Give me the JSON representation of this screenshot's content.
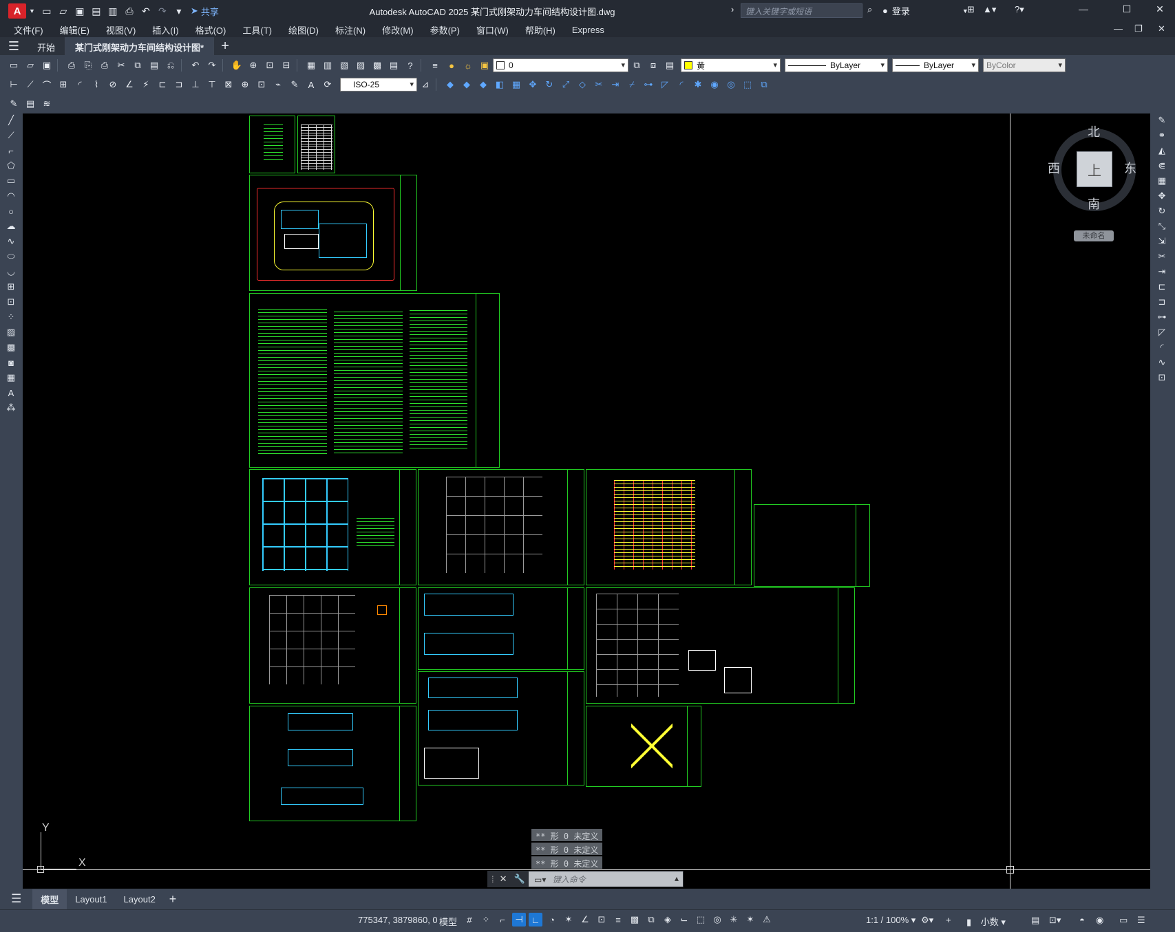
{
  "titlebar": {
    "logo": "A",
    "share_label": "共享",
    "window_title": "Autodesk AutoCAD 2025    某门式刚架动力车间结构设计图.dwg",
    "search_placeholder": "键入关键字或短语",
    "login_label": "登录"
  },
  "menubar": {
    "items": [
      "文件(F)",
      "编辑(E)",
      "视图(V)",
      "插入(I)",
      "格式(O)",
      "工具(T)",
      "绘图(D)",
      "标注(N)",
      "修改(M)",
      "参数(P)",
      "窗口(W)",
      "帮助(H)",
      "Express"
    ]
  },
  "tabs": {
    "start": "开始",
    "document": "某门式刚架动力车间结构设计图*"
  },
  "toolbar": {
    "layer_value": "0",
    "color_value": "黄",
    "linetype_value": "ByLayer",
    "lineweight_value": "ByLayer",
    "plotstyle_value": "ByColor",
    "dimstyle_value": "ISO-25",
    "colors": {
      "yellow": "#ffff00"
    }
  },
  "viewcube": {
    "north": "北",
    "south": "南",
    "east": "东",
    "west": "西",
    "face": "上",
    "named_view": "未命名"
  },
  "ucs": {
    "x": "X",
    "y": "Y"
  },
  "command": {
    "history": [
      "** 形 0 未定义",
      "** 形 0 未定义",
      "** 形 0 未定义"
    ],
    "placeholder": "键入命令"
  },
  "layout_tabs": [
    "模型",
    "Layout1",
    "Layout2"
  ],
  "statusbar": {
    "coords": "775347, 3879860, 0",
    "model_label": "模型",
    "scale": "1:1 / 100%",
    "units": "小数"
  },
  "theme": {
    "sheet_border": "#22cc22",
    "background": "#000000",
    "accent": "#1e78d6"
  }
}
